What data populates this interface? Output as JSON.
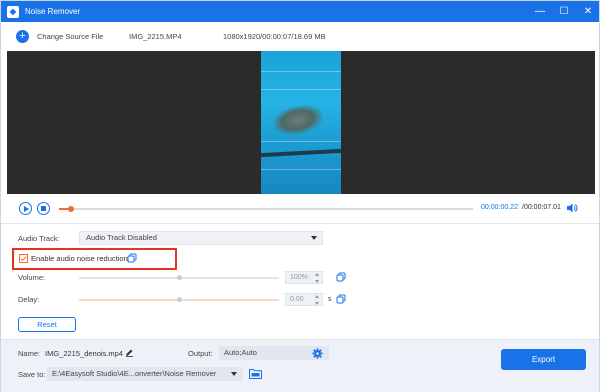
{
  "window": {
    "title": "Noise Remover",
    "controls": {
      "minimize": "—",
      "maximize": "☐",
      "close": "✕"
    }
  },
  "file_bar": {
    "change_source_label": "Change Source File",
    "file_name": "IMG_2215.MP4",
    "file_meta": "1080x1920/00:00:07/18.69 MB"
  },
  "playback": {
    "current_time": "00:00:00.22",
    "total_time": "/00:00:07.01",
    "progress_fraction": 0.03
  },
  "settings": {
    "audio_track_label": "Audio Track:",
    "audio_track_value": "Audio Track Disabled",
    "noise_reduction_label": "Enable audio noise reduction",
    "noise_reduction_checked": true,
    "volume_label": "Volume:",
    "volume_value": "100%",
    "volume_fraction": 0.5,
    "delay_label": "Delay:",
    "delay_value": "0.00",
    "delay_unit": "s",
    "delay_fraction": 0.5,
    "reset_label": "Reset"
  },
  "bottom": {
    "name_label": "Name:",
    "name_value": "IMG_2215_denois.mp4",
    "output_label": "Output:",
    "output_value": "Auto;Auto",
    "save_to_label": "Save to:",
    "save_to_value": "E:\\4Easysoft Studio\\4E...onverter\\Noise Remover",
    "export_label": "Export"
  },
  "colors": {
    "accent": "#1a72e8",
    "progress": "#f26b3a",
    "highlight_box": "#e53223"
  },
  "icons": [
    "app-logo-icon",
    "plus-icon",
    "play-icon",
    "stop-icon",
    "volume-icon",
    "copy-icon",
    "edit-icon",
    "gear-icon",
    "folder-icon",
    "chevron-down-icon"
  ]
}
